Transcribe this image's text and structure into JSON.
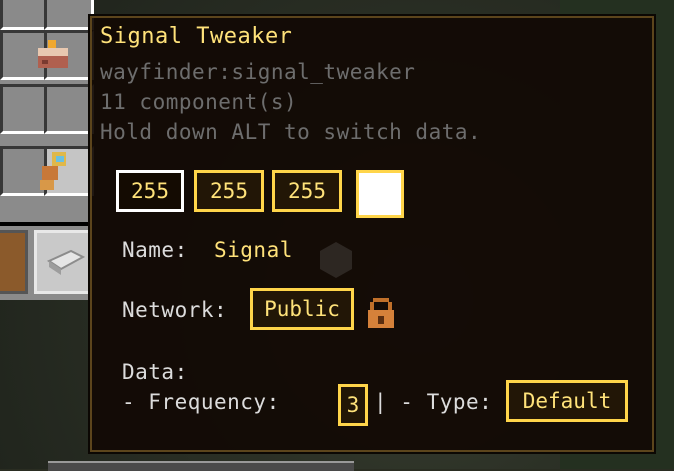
{
  "tooltip": {
    "title": "Signal Tweaker",
    "item_id": "wayfinder:signal_tweaker",
    "components": "11 component(s)",
    "hint": "Hold down ALT to switch data.",
    "rgb": [
      "255",
      "255",
      "255"
    ],
    "swatch_color": "#ffffff",
    "name_label": "Name:",
    "name_value": "Signal",
    "network_label": "Network:",
    "network_value": "Public",
    "data_label": "Data:",
    "frequency_label": "- Frequency:",
    "frequency_value": "3",
    "frequency_suffix": "| - Type:",
    "type_value": "Default"
  },
  "colors": {
    "accent": "#ffd54a",
    "title": "#ffe27a",
    "muted": "#6d6d6d",
    "text": "#dcdcdc"
  },
  "icons": [
    "cake-icon",
    "compass-icon",
    "iron-ingot-icon",
    "lock-icon"
  ]
}
